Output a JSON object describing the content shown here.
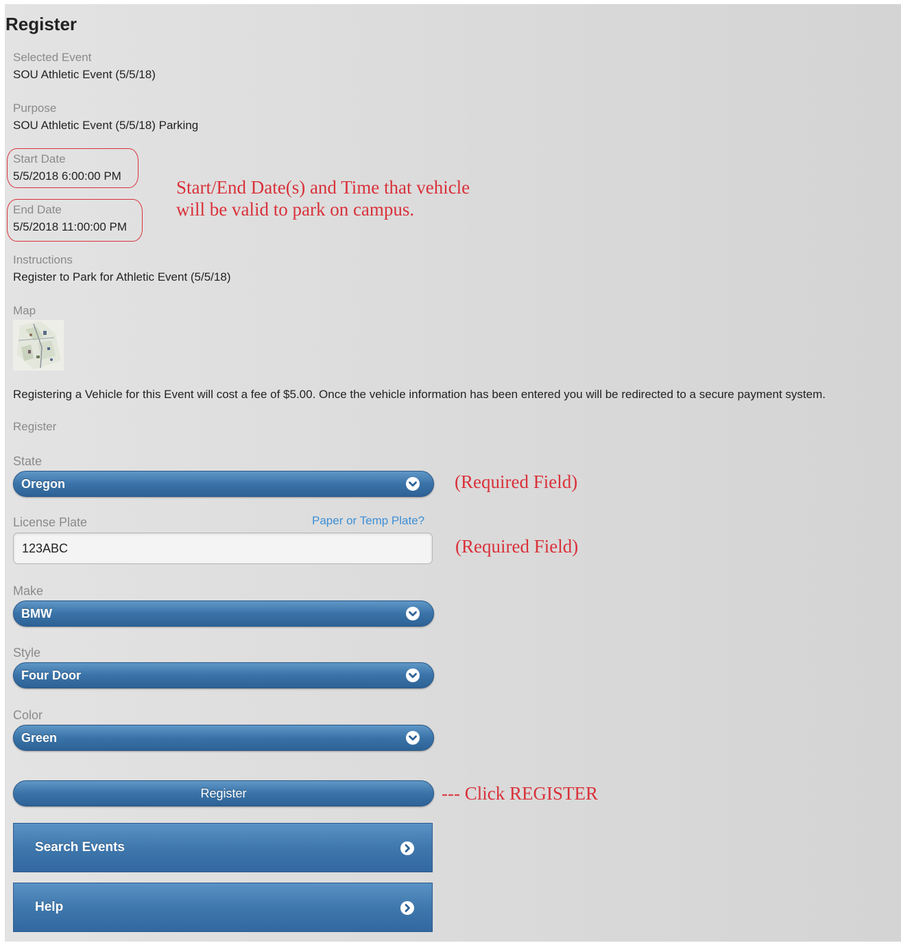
{
  "page_title": "Register",
  "fields": {
    "selected_event": {
      "label": "Selected Event",
      "value": "SOU Athletic Event (5/5/18)"
    },
    "purpose": {
      "label": "Purpose",
      "value": "SOU Athletic Event (5/5/18) Parking"
    },
    "start_date": {
      "label": "Start Date",
      "value": "5/5/2018 6:00:00 PM"
    },
    "end_date": {
      "label": "End Date",
      "value": "5/5/2018 11:00:00 PM"
    },
    "instructions": {
      "label": "Instructions",
      "value": "Register to Park for Athletic Event (5/5/18)"
    },
    "map": {
      "label": "Map"
    }
  },
  "fee_notice": "Registering a Vehicle for this Event will cost a fee of $5.00. Once the vehicle information has been entered you will be redirected to a secure payment system.",
  "register_section_label": "Register",
  "form": {
    "state": {
      "label": "State",
      "value": "Oregon"
    },
    "license_plate": {
      "label": "License Plate",
      "value": "123ABC",
      "link": "Paper or Temp Plate?"
    },
    "make": {
      "label": "Make",
      "value": "BMW"
    },
    "style": {
      "label": "Style",
      "value": "Four Door"
    },
    "color": {
      "label": "Color",
      "value": "Green"
    },
    "submit_label": "Register"
  },
  "nav": {
    "search_events": "Search Events",
    "help": "Help"
  },
  "annotations": {
    "dates_line1": "Start/End Date(s) and Time that vehicle",
    "dates_line2": "will be valid to park on campus.",
    "required_state": "(Required Field)",
    "required_plate": "(Required Field)",
    "click_register": "--- Click REGISTER"
  },
  "colors": {
    "button_blue": "#3a73a8",
    "annotation_red": "#d9313a",
    "link_blue": "#3d8fd6"
  },
  "icons": {
    "select_arrow": "chevron-down-icon",
    "nav_arrow": "chevron-right-icon"
  }
}
